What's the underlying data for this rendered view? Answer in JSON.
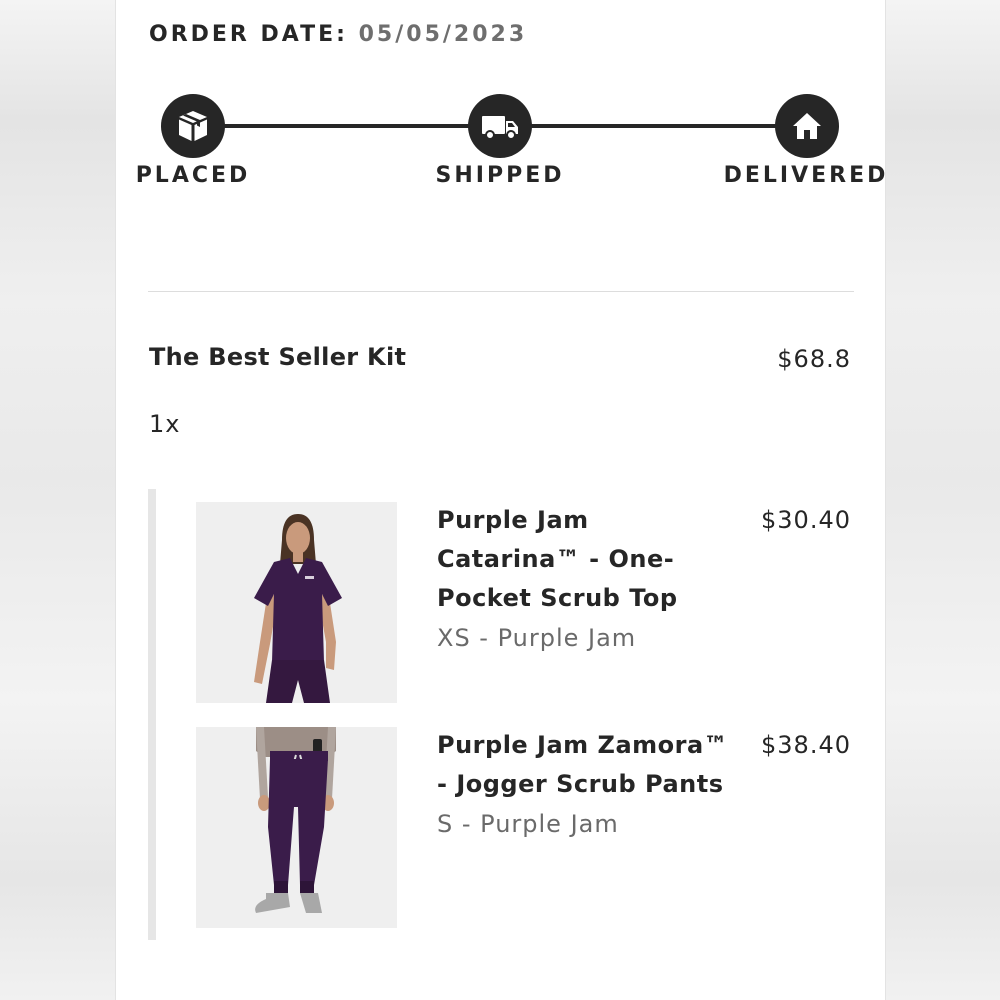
{
  "order": {
    "date_label": "ORDER DATE:",
    "date_value": "05/05/2023"
  },
  "tracker": {
    "steps": [
      {
        "label": "PLACED",
        "icon": "package-icon"
      },
      {
        "label": "SHIPPED",
        "icon": "truck-icon"
      },
      {
        "label": "DELIVERED",
        "icon": "home-icon"
      }
    ],
    "color": "#262626"
  },
  "kit": {
    "name": "The Best Seller Kit",
    "price": "$68.8",
    "quantity": "1x",
    "items": [
      {
        "name": "Purple Jam Catarina™ - One-Pocket Scrub Top",
        "name_lines": [
          "Purple Jam",
          "Catarina™ - One-",
          "Pocket Scrub Top"
        ],
        "variant": "XS - Purple Jam",
        "price": "$30.40",
        "image": "scrub-top-photo"
      },
      {
        "name": "Purple Jam Zamora™ - Jogger Scrub Pants",
        "name_lines": [
          "Purple Jam Zamora™",
          "- Jogger Scrub Pants"
        ],
        "variant": "S - Purple Jam",
        "price": "$38.40",
        "image": "scrub-pants-photo"
      }
    ]
  },
  "colors": {
    "text": "#262626",
    "muted": "#6a6a6a",
    "product": "#3a1c4a"
  }
}
